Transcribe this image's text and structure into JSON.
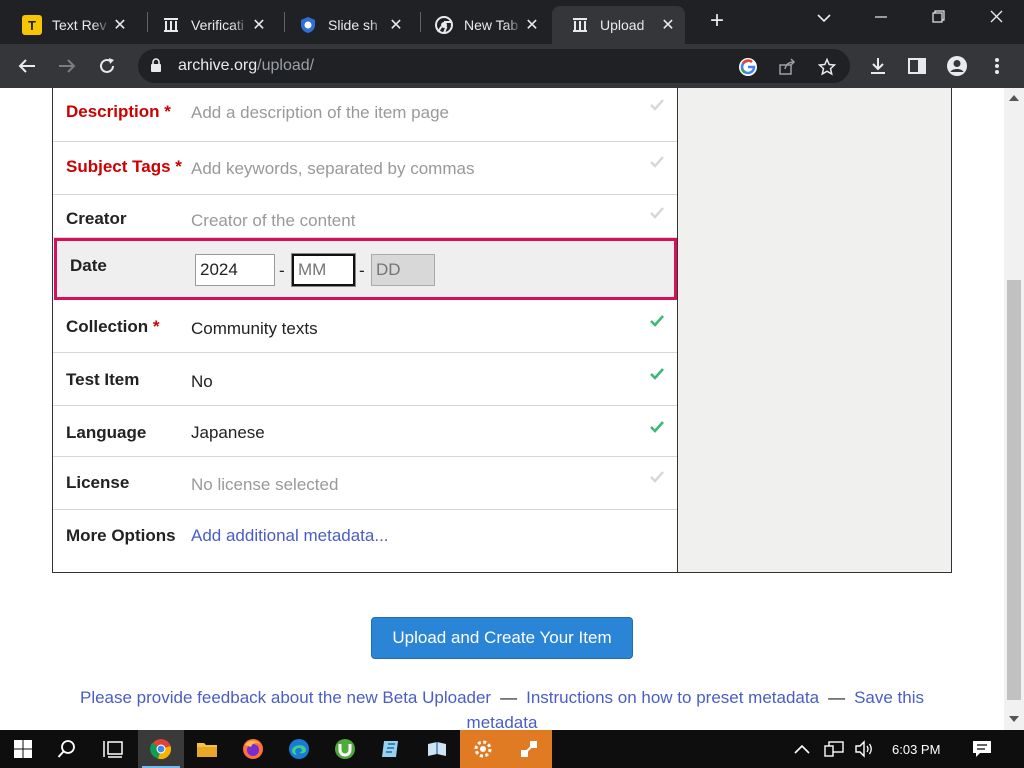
{
  "browser": {
    "tabs": [
      {
        "title": "Text Rev",
        "favicon": "T",
        "favicon_color": "#f7c600",
        "active": false
      },
      {
        "title": "Verificati",
        "favicon": "archive-icon",
        "active": false
      },
      {
        "title": "Slide sh",
        "favicon": "shield-icon",
        "active": false
      },
      {
        "title": "New Tab",
        "favicon": "chrome-icon",
        "active": false
      },
      {
        "title": "Upload",
        "favicon": "archive-icon",
        "active": true
      }
    ],
    "url_host": "archive.org",
    "url_path": "/upload/"
  },
  "form": {
    "rows": [
      {
        "label": "Description",
        "required": true,
        "value": "Add a description of the item page",
        "placeholder": true,
        "check": "grey"
      },
      {
        "label": "Subject Tags",
        "required": true,
        "value": "Add keywords, separated by commas",
        "placeholder": true,
        "check": "grey"
      },
      {
        "label": "Creator",
        "required": false,
        "value": "Creator of the content",
        "placeholder": true,
        "check": "grey"
      },
      {
        "label": "Collection",
        "required": true,
        "value": "Community texts",
        "placeholder": false,
        "check": "green"
      },
      {
        "label": "Test Item",
        "required": false,
        "value": "No",
        "placeholder": false,
        "check": "green"
      },
      {
        "label": "Language",
        "required": false,
        "value": "Japanese",
        "placeholder": false,
        "check": "green"
      },
      {
        "label": "License",
        "required": false,
        "value": "No license selected",
        "placeholder": true,
        "check": "grey"
      },
      {
        "label": "More Options",
        "required": false,
        "value": "Add additional metadata...",
        "link": true
      }
    ],
    "date": {
      "label": "Date",
      "year": "2024",
      "month_placeholder": "MM",
      "day_placeholder": "DD",
      "separator": "-"
    },
    "required_marker": "*"
  },
  "actions": {
    "upload_label": "Upload and Create Your Item"
  },
  "footer": {
    "feedback_link": "Please provide feedback about the new Beta Uploader",
    "instructions_link": "Instructions on how to preset metadata",
    "save_link": "Save this metadata",
    "separator": "—"
  },
  "taskbar": {
    "time": "6:03 PM"
  },
  "colors": {
    "required": "#cc0000",
    "link": "#4a5dc6",
    "check_ok": "#3cb878",
    "date_highlight": "#d6115c",
    "button": "#2a85d6"
  }
}
